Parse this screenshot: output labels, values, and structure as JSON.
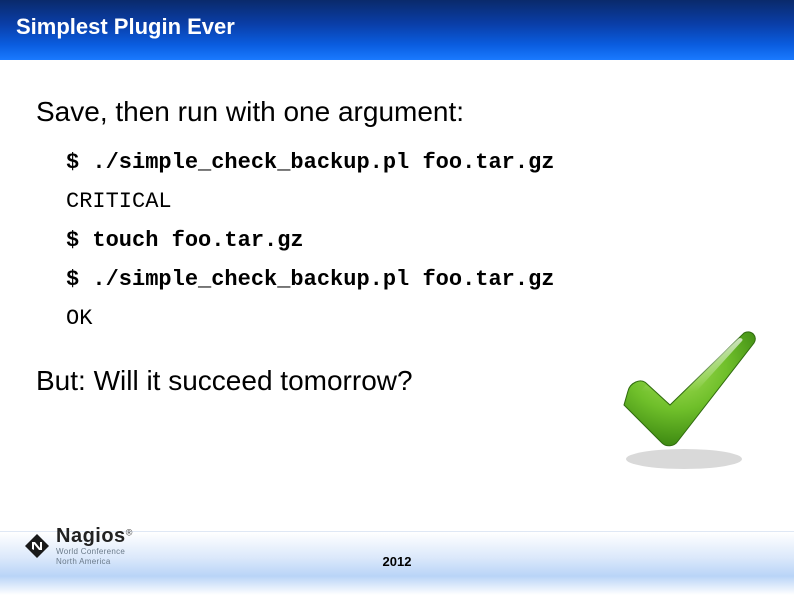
{
  "title": "Simplest Plugin Ever",
  "body": {
    "heading": "Save, then run with one argument:",
    "lines": [
      "$ ./simple_check_backup.pl foo.tar.gz",
      "CRITICAL",
      "$ touch foo.tar.gz",
      "$ ./simple_check_backup.pl foo.tar.gz",
      "OK"
    ],
    "closing": "But: Will it succeed tomorrow?"
  },
  "footer": {
    "logo_name": "Nagios",
    "logo_sub": "World Conference",
    "logo_sub2": "North America",
    "year": "2012"
  },
  "icons": {
    "checkmark": "checkmark-icon",
    "logo": "nagios-logo"
  }
}
